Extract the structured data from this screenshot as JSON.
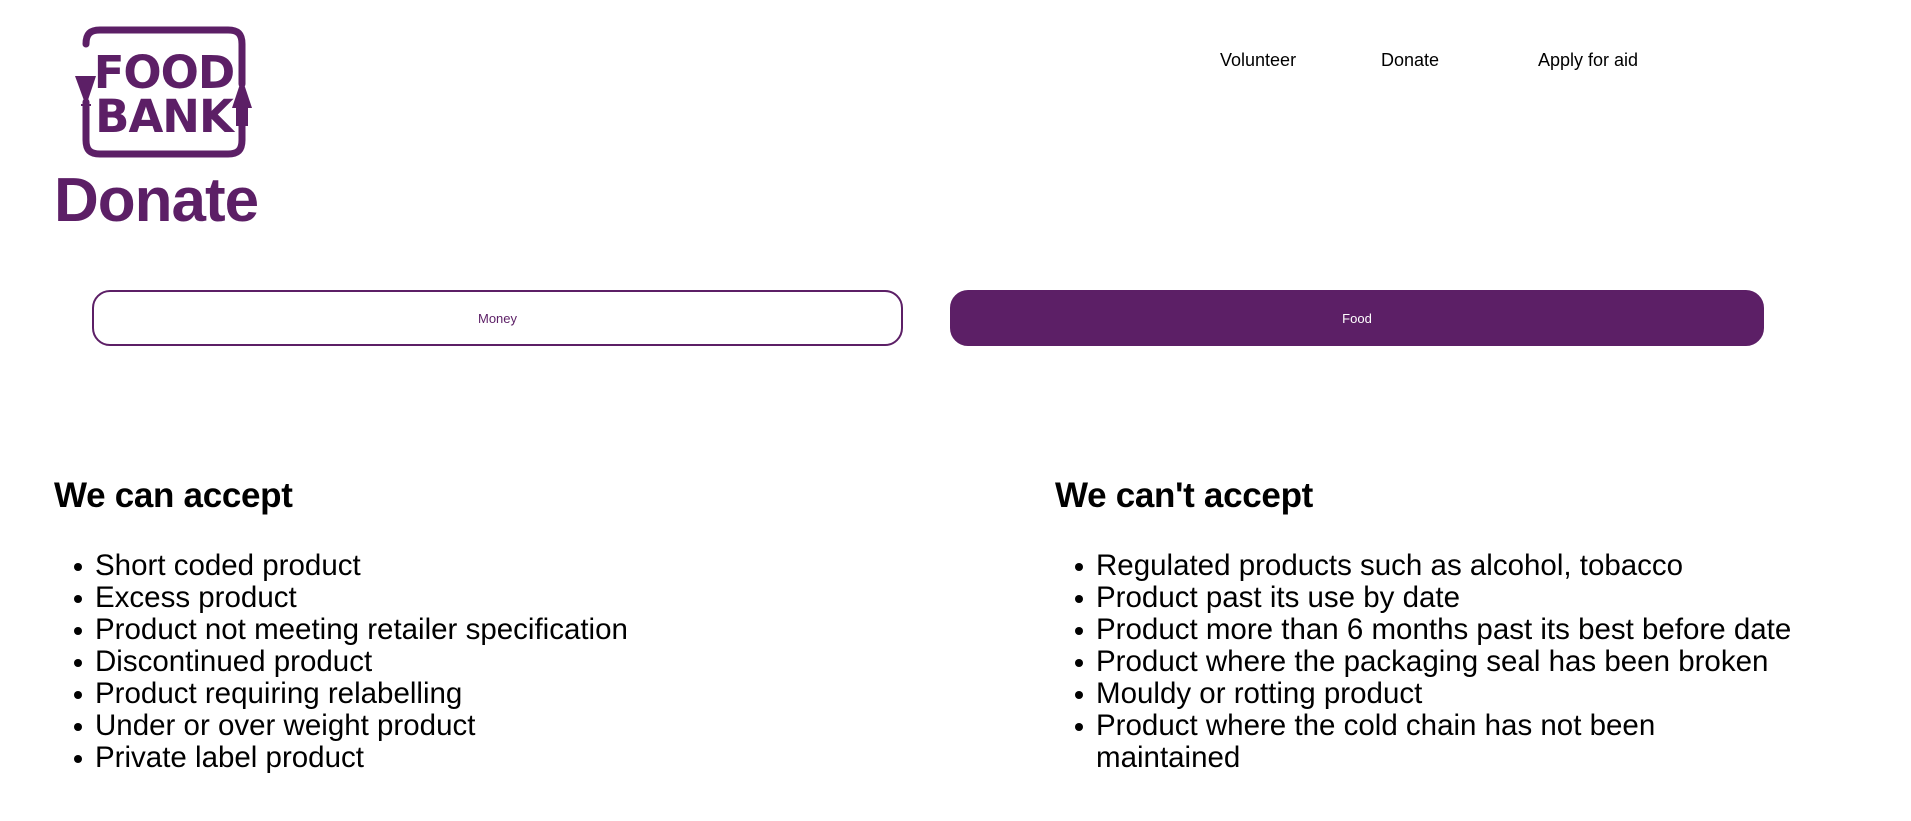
{
  "brand": {
    "logo_line1": "FOOD",
    "logo_line2": "BANK",
    "color": "#5c1f66"
  },
  "nav": {
    "items": [
      {
        "label": "Volunteer"
      },
      {
        "label": "Donate"
      },
      {
        "label": "Apply for aid"
      }
    ]
  },
  "page": {
    "title": "Donate"
  },
  "tabs": [
    {
      "label": "Money",
      "selected": false
    },
    {
      "label": "Food",
      "selected": true
    }
  ],
  "accept": {
    "heading": "We can accept",
    "items": [
      "Short coded product",
      "Excess product",
      "Product not meeting retailer specification",
      "Discontinued product",
      "Product requiring relabelling",
      "Under or over weight product",
      "Private label product"
    ]
  },
  "reject": {
    "heading": "We can't accept",
    "items": [
      "Regulated products such as alcohol, tobacco",
      "Product past its use by date",
      "Product more than 6 months past its best before date",
      "Product where the packaging seal has been broken",
      "Mouldy or rotting product",
      "Product where the cold chain has not been maintained"
    ]
  }
}
